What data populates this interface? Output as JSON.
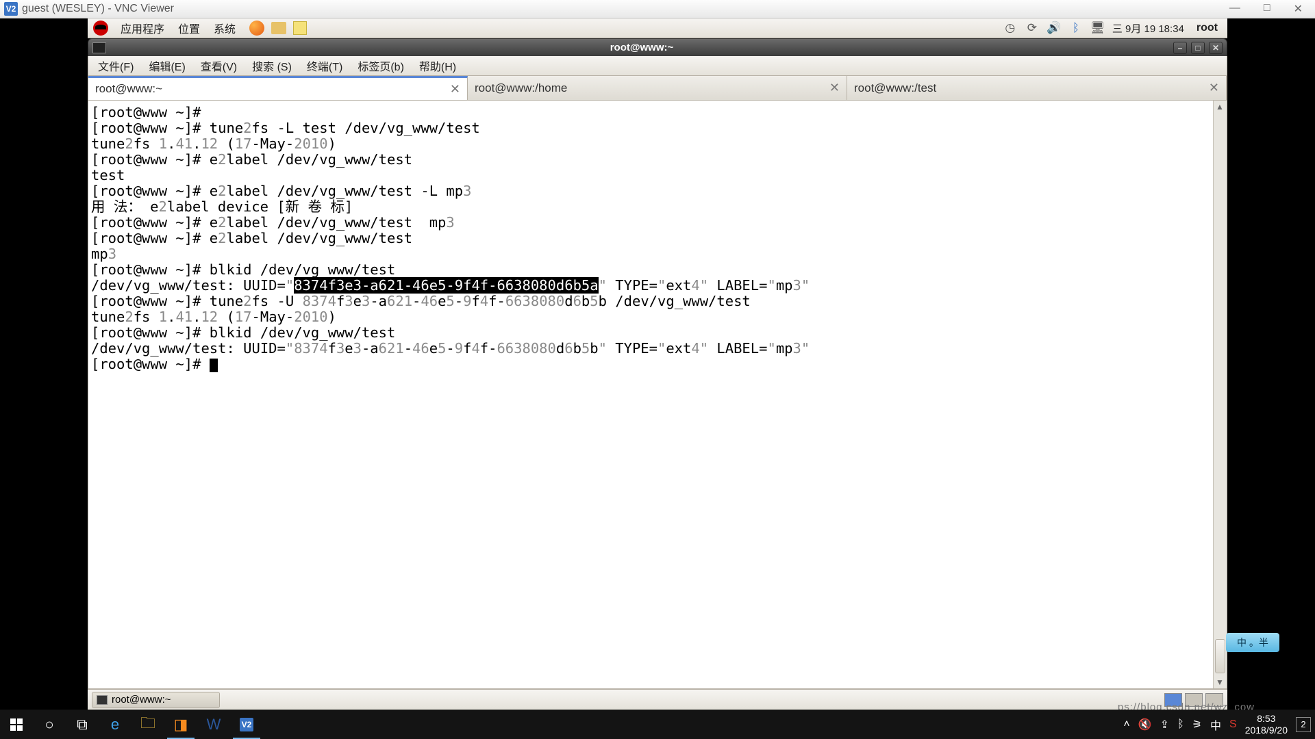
{
  "vnc": {
    "title": "guest (WESLEY) - VNC Viewer",
    "icon_text": "V2",
    "min": "—",
    "max": "□",
    "close": "✕"
  },
  "gnome_top": {
    "apps": "应用程序",
    "places": "位置",
    "system": "系统",
    "clock": "三 9月 19 18:34",
    "user": "root"
  },
  "term": {
    "title": "root@www:~",
    "menu": {
      "file": "文件(F)",
      "edit": "编辑(E)",
      "view": "查看(V)",
      "search": "搜索 (S)",
      "terminal": "终端(T)",
      "tabs": "标签页(b)",
      "help": "帮助(H)"
    },
    "tabs": [
      {
        "label": "root@www:~",
        "active": true
      },
      {
        "label": "root@www:/home",
        "active": false
      },
      {
        "label": "root@www:/test",
        "active": false
      }
    ],
    "lines": {
      "p1": "[root@www ~]# ",
      "p2": "[root@www ~]# tune",
      "p2a": "fs -L test /dev/vg_www/test",
      "p3a": "tune",
      "p3b": "fs ",
      "p3c": ".",
      "p3d": ".",
      "p3e": " (",
      "p3f": "-May-",
      "p3g": ")",
      "n_1": "1",
      "n_41": "41",
      "n_12": "12",
      "n_17": "17",
      "n_2010": "2010",
      "n_2": "2",
      "p4": "[root@www ~]# e",
      "p4b": "label /dev/vg_www/test",
      "out_test": "test",
      "p5": "[root@www ~]# e",
      "p5b": "label /dev/vg_www/test -L mp",
      "n_3": "3",
      "usage_a": "用 法： e",
      "usage_b": "label device [新 卷 标]",
      "p6": "[root@www ~]# e",
      "p6b": "label /dev/vg_www/test  mp",
      "p7": "[root@www ~]# e",
      "p7b": "label /dev/vg_www/test",
      "out_mp": "mp",
      "p8": "[root@www ~]# blkid /dev/vg_www/test",
      "blk_a": "/dev/vg_www/test: UUID=",
      "q": "\"",
      "uuid_sel_a": "8374",
      "uuid_sel_b": "f",
      "uuid_sel_c": "e",
      "uuid_sel_d": "-a",
      "uuid_sel_e": "621",
      "uuid_sel_f": "-",
      "uuid_sel_g": "46",
      "uuid_sel_h": "e",
      "uuid_sel_i": "5",
      "uuid_sel_j": "-",
      "uuid_sel_k": "9",
      "uuid_sel_l": "f",
      "uuid_sel_m": "4",
      "uuid_sel_n": "f-",
      "uuid_sel_o": "6638080",
      "uuid_sel_p": "d",
      "uuid_sel_q": "6",
      "uuid_sel_r": "b",
      "uuid_sel_s": "5",
      "uuid_sel_t": "a",
      "blk_type": " TYPE=",
      "blk_ext": "ext",
      "n_4": "4",
      "blk_label": " LABEL=",
      "blk_mp": "mp",
      "p9": "[root@www ~]# tune",
      "p9b": "fs -U ",
      "u2a": "8374",
      "u2b": "f",
      "u2c": "e",
      "u2d": "-a",
      "u2e": "621",
      "u2f": "-",
      "u2g": "46",
      "u2h": "e",
      "u2i": "5",
      "u2j": "-",
      "u2k": "9",
      "u2l": "f",
      "u2m": "4",
      "u2n": "f-",
      "u2o": "6638080",
      "u2p": "d",
      "u2q": "6",
      "u2r": "b",
      "u2s": "5",
      "u2t": "b",
      "p9c": " /dev/vg_www/test",
      "p10": "[root@www ~]# blkid /dev/vg_www/test",
      "blk2": "/dev/vg_www/test: UUID=",
      "u3a": "8374",
      "u3b": "f",
      "u3c": "e",
      "u3d": "-a",
      "u3e": "621",
      "u3f": "-",
      "u3g": "46",
      "u3h": "e",
      "u3i": "5",
      "u3j": "-",
      "u3k": "9",
      "u3l": "f",
      "u3m": "4",
      "u3n": "f-",
      "u3o": "6638080",
      "u3p": "d",
      "u3q": "6",
      "u3r": "b",
      "u3s": "5",
      "u3t": "b",
      "pEnd": "[root@www ~]# "
    }
  },
  "gnome_bottom": {
    "task": "root@www:~"
  },
  "win_taskbar": {
    "time": "8:53",
    "date": "2018/9/20",
    "notif_count": "2"
  },
  "ime": "中 。半",
  "watermark": "ps://blog.csdn.net/wz_cow"
}
